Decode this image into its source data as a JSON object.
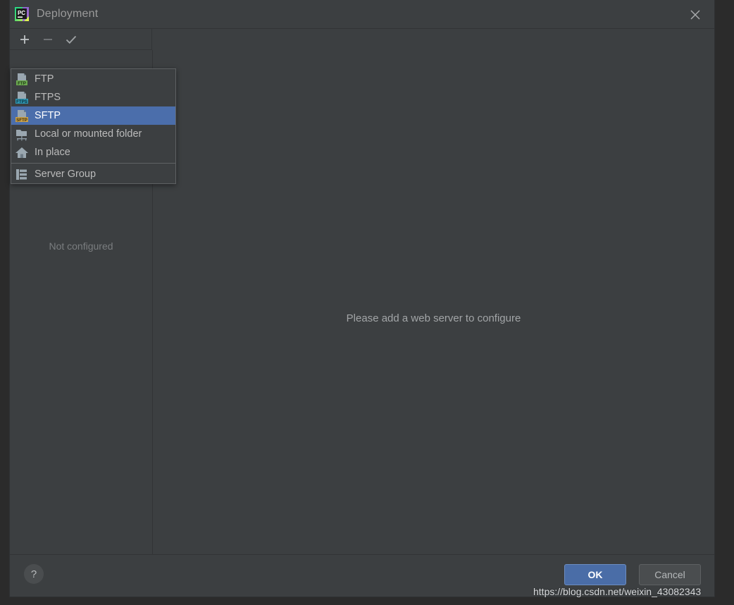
{
  "window": {
    "title": "Deployment",
    "app_icon": "pycharm-logo-icon",
    "close_icon": "close-icon"
  },
  "toolbar": {
    "add_label": "+",
    "add_icon": "plus-icon",
    "remove_label": "−",
    "remove_icon": "minus-icon",
    "apply_icon": "check-icon"
  },
  "popup": {
    "items": [
      {
        "label": "FTP",
        "icon": "ftp-server-icon",
        "badge": "FTP",
        "badge_color": "#6aa84f",
        "selected": false
      },
      {
        "label": "FTPS",
        "icon": "ftps-server-icon",
        "badge": "FTPS",
        "badge_color": "#2e97b3",
        "selected": false
      },
      {
        "label": "SFTP",
        "icon": "sftp-server-icon",
        "badge": "SFTP",
        "badge_color": "#c9a14b",
        "selected": true
      },
      {
        "label": "Local or mounted folder",
        "icon": "network-folder-icon",
        "badge": "",
        "badge_color": "",
        "selected": false
      },
      {
        "label": "In place",
        "icon": "home-icon",
        "badge": "",
        "badge_color": "",
        "selected": false
      },
      {
        "label": "Server Group",
        "icon": "server-group-icon",
        "badge": "",
        "badge_color": "",
        "selected": false
      }
    ],
    "separator_after_index": 4
  },
  "left_panel": {
    "empty_text": "Not configured"
  },
  "right_panel": {
    "placeholder_text": "Please add a web server to configure"
  },
  "footer": {
    "help_label": "?",
    "ok_label": "OK",
    "cancel_label": "Cancel"
  },
  "watermark": {
    "text": "https://blog.csdn.net/weixin_43082343"
  },
  "colors": {
    "dialog_bg": "#3c3f41",
    "backdrop": "#2b2b2b",
    "selection_blue": "#4b6eab",
    "ok_blue": "#4a6da7",
    "border": "#323436",
    "popup_border": "#5e6163"
  }
}
